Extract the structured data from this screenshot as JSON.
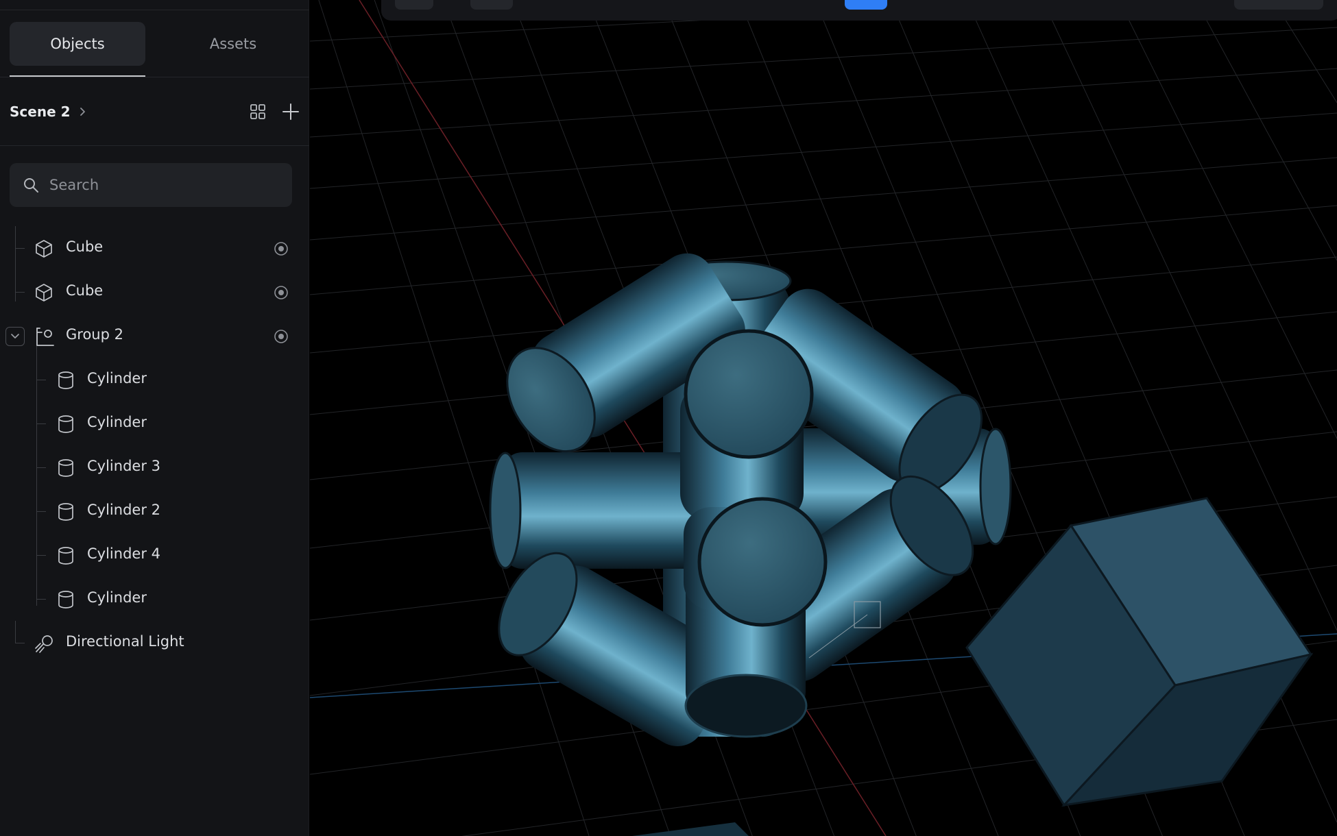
{
  "sidebar": {
    "tabs": [
      {
        "label": "Objects",
        "active": true
      },
      {
        "label": "Assets",
        "active": false
      }
    ],
    "scene": {
      "title": "Scene 2"
    },
    "search": {
      "placeholder": "Search",
      "value": ""
    },
    "tree": [
      {
        "label": "Cube",
        "icon": "cube-icon",
        "depth": 0
      },
      {
        "label": "Cube",
        "icon": "cube-icon",
        "depth": 0
      },
      {
        "label": "Group 2",
        "icon": "group-icon",
        "depth": 0,
        "expanded": true
      },
      {
        "label": "Cylinder",
        "icon": "cylinder-icon",
        "depth": 1
      },
      {
        "label": "Cylinder",
        "icon": "cylinder-icon",
        "depth": 1
      },
      {
        "label": "Cylinder 3",
        "icon": "cylinder-icon",
        "depth": 1
      },
      {
        "label": "Cylinder 2",
        "icon": "cylinder-icon",
        "depth": 1
      },
      {
        "label": "Cylinder 4",
        "icon": "cylinder-icon",
        "depth": 1
      },
      {
        "label": "Cylinder",
        "icon": "cylinder-icon",
        "depth": 1
      },
      {
        "label": "Directional Light",
        "icon": "directional-light-icon",
        "depth": 0
      }
    ]
  },
  "colors": {
    "sidebar_bg": "#131417",
    "viewport_bg": "#000000",
    "accent": "#2f7ef5",
    "object_color": "#2b5a6e"
  }
}
